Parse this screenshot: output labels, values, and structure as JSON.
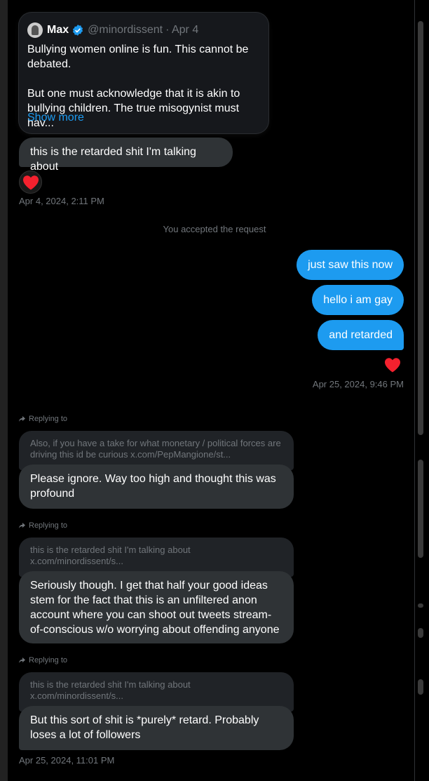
{
  "quoted_tweet": {
    "name": "Max",
    "handle": "@minordissent",
    "date": "· Apr 4",
    "text_p1": "Bullying women online is fun. This cannot be debated.",
    "text_p2": "But one must acknowledge that it is akin to bullying children. The true misogynist must hav...",
    "show_more": "Show more"
  },
  "messages": {
    "msg1": "this is the retarded shit I'm talking about",
    "reaction1": "heart",
    "ts1": "Apr 4, 2024, 2:11 PM",
    "system_note": "You accepted the request",
    "out1": "just saw this now",
    "out2": "hello i am gay",
    "out3": "and retarded",
    "reaction2": "heart",
    "ts2": "Apr 25, 2024, 9:46 PM",
    "replying_to": "Replying to",
    "r1_quote": "Also, if you have a take for what monetary / political forces are driving this id be curious x.com/PepMangione/st...",
    "r1_msg": "Please ignore. Way too high and thought this was profound",
    "r2_quote": "this is the retarded shit I'm talking about x.com/minordissent/s...",
    "r2_msg": "Seriously though. I get that half your good ideas stem for the fact that this is an unfiltered anon account where you can shoot out tweets stream-of-conscious w/o worrying about offending anyone",
    "r3_quote": "this is the retarded shit I'm talking about x.com/minordissent/s...",
    "r3_msg": "But this sort of shit is *purely* retard. Probably loses a lot of followers",
    "ts3": "Apr 25, 2024, 11:01 PM"
  },
  "colors": {
    "accent": "#1d9bf0",
    "heart": "#f91880"
  }
}
